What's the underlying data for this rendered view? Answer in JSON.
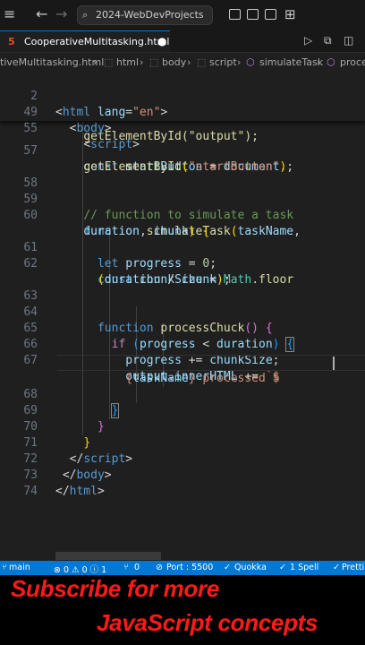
{
  "titlebar": {
    "back_icon": "arrow-left-icon",
    "forward_icon": "arrow-right-icon",
    "search_text": "2024-WebDevProjects"
  },
  "tab": {
    "label": "CooperativeMultitasking.html",
    "icon": "html5-icon",
    "modified_dot": "●"
  },
  "breadcrumb": [
    "tiveMultitasking.html",
    "html",
    "body",
    "script",
    "simulateTask",
    "proce"
  ],
  "line_numbers": [
    "2",
    "49",
    "55",
    "57",
    "58",
    "59",
    "60",
    "",
    "61",
    "62",
    "",
    "63",
    "64",
    "65",
    "66",
    "67",
    "",
    "68",
    "69",
    "70",
    "71",
    "72",
    "73",
    "74"
  ],
  "code": {
    "sticky_l1_tag": "html",
    "sticky_l1_attr": "lang",
    "sticky_l1_val": "\"en\"",
    "sticky_l2_tag": "body",
    "sticky_l3_tag": "script",
    "partial_line": "getElementById(\"output\");",
    "l57_kw": "const",
    "l57_var": "startButton",
    "l57_eq": " = ",
    "l57_obj": "document",
    "l57b_fn": "getElementById",
    "l57b_str": "\"startButton\"",
    "l59_comment": "// function to simulate a task",
    "l60_kw": "function",
    "l60_fn": "simulateTask",
    "l60_p1": "taskName",
    "l60b_p2": "duration",
    "l60b_p3": "chunk",
    "l61_kw": "let",
    "l61_var": "progress",
    "l61_num": "0",
    "l62_kw": "const",
    "l62_var": "chunkSize",
    "l62_obj": "Math",
    "l62_fn": "floor",
    "l62b_a": "duration",
    "l62b_b": "chunk",
    "l64_kw": "function",
    "l64_fn": "processChuck",
    "l65_kw": "if",
    "l65_a": "progress",
    "l65_b": "duration",
    "l66_a": "progress",
    "l66_b": "chunkSize",
    "l67_a": "output",
    "l67_b": "innerHTML",
    "l67_str": "`$",
    "l67b_var": "taskName",
    "l67b_str": " processed $",
    "l72_tag": "body",
    "l73_tag": "html"
  },
  "statusbar": {
    "branch": "main",
    "problems": "⊗ 0 ⚠ 0 ⓘ 1",
    "ports_count": "0",
    "port": "Port : 5500",
    "quokka": "Quokka",
    "spell": "1 Spell",
    "prettier": "Pretti"
  },
  "overlay": {
    "line1": "Subscribe for more",
    "line2": "JavaScript concepts"
  },
  "colors": {
    "accent": "#0078d4",
    "caption": "#ff1a1a"
  }
}
